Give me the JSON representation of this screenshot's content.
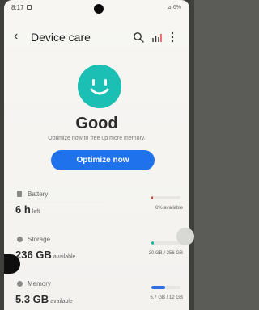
{
  "status_bar": {
    "time": "8:17",
    "signal_battery": "⊿ 6%"
  },
  "app_bar": {
    "title": "Device care",
    "back_icon": "back-arrow",
    "actions": [
      "search-icon",
      "chart-icon",
      "more-icon"
    ]
  },
  "summary": {
    "status": "Good",
    "hint": "Optimize now to free up more memory.",
    "button_label": "Optimize now"
  },
  "battery": {
    "label": "Battery",
    "value": "6 h",
    "unit": "left",
    "meta": "6% available",
    "fill": 0.06,
    "color": "#e53935"
  },
  "storage": {
    "label": "Storage",
    "value": "236 GB",
    "unit": "available",
    "meta": "20 GB / 256 GB",
    "fill": 0.08,
    "color": "#20b6a8"
  },
  "memory": {
    "label": "Memory",
    "value": "5.3 GB",
    "unit": "available",
    "meta": "5.7 GB / 12 GB",
    "fill": 0.48,
    "color": "#2f6fdf"
  },
  "colors": {
    "accent": "#1f72eb",
    "face": "#1bbfb3"
  }
}
